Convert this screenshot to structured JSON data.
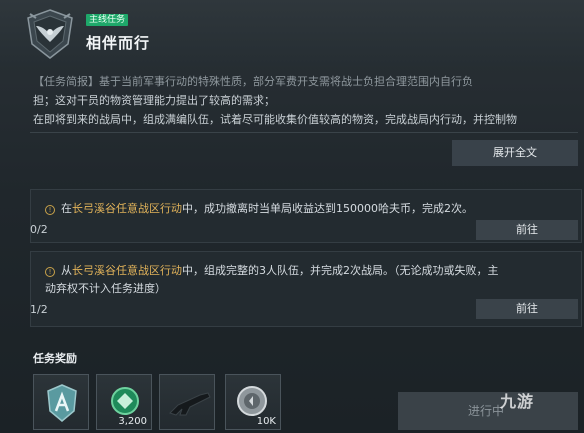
{
  "header": {
    "tag": "主线任务",
    "title": "相伴而行"
  },
  "briefing": {
    "line1": "【任务简报】基于当前军事行动的特殊性质，部分军费开支需将战士负担合理范围内自行负",
    "line2": "担；这对干员的物资管理能力提出了较高的需求；",
    "line3": "在即将到来的战局中，组成满编队伍，试着尽可能收集价值较高的物资，完成战局内行动，并控制物"
  },
  "expand_label": "展开全文",
  "objectives": [
    {
      "pre": "在",
      "highlight": "长弓溪谷任意战区行动",
      "post": "中，成功撤离时当单局收益达到150000哈夫币，完成2次。",
      "progress": "0/2",
      "button": "前往"
    },
    {
      "pre": "从",
      "highlight": "长弓溪谷任意战区行动",
      "post": "中，组成完整的3人队伍，并完成2次战局。（无论成功或失败，主",
      "line2": "动弃权不计入任务进度）",
      "progress": "1/2",
      "button": "前往"
    }
  ],
  "rewards": {
    "title": "任务奖励",
    "items": [
      {
        "icon": "badge-icon",
        "qty": ""
      },
      {
        "icon": "medal-icon",
        "qty": "3,200"
      },
      {
        "icon": "rifle-icon",
        "qty": ""
      },
      {
        "icon": "coin-icon",
        "qty": "10K"
      }
    ]
  },
  "progress_button": "进行中",
  "watermark": "九游"
}
